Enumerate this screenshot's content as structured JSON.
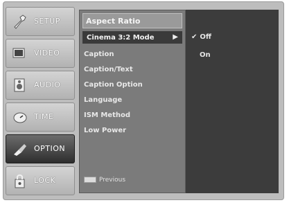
{
  "sidebar": {
    "items": [
      {
        "label": "SETUP",
        "icon": "wrench-icon"
      },
      {
        "label": "VIDEO",
        "icon": "monitor-icon"
      },
      {
        "label": "AUDIO",
        "icon": "speaker-icon"
      },
      {
        "label": "TIME",
        "icon": "clock-icon"
      },
      {
        "label": "OPTION",
        "icon": "option-icon"
      },
      {
        "label": "LOCK",
        "icon": "lock-icon"
      }
    ],
    "active": "OPTION"
  },
  "menu": {
    "title": "Aspect Ratio",
    "items": [
      {
        "label": "Cinema 3:2 Mode",
        "selected": true
      },
      {
        "label": "Caption"
      },
      {
        "label": "Caption/Text"
      },
      {
        "label": "Caption Option"
      },
      {
        "label": "Language"
      },
      {
        "label": "ISM Method"
      },
      {
        "label": "Low Power"
      }
    ],
    "footer": "Previous"
  },
  "submenu": {
    "options": [
      {
        "label": "Off",
        "checked": true
      },
      {
        "label": "On",
        "checked": false
      }
    ]
  },
  "colors": {
    "frame": "#bdbdbd",
    "menu_bg": "#7b7b7b",
    "submenu_bg": "#3c3c3c",
    "active_tab": "#3a3a3a"
  }
}
